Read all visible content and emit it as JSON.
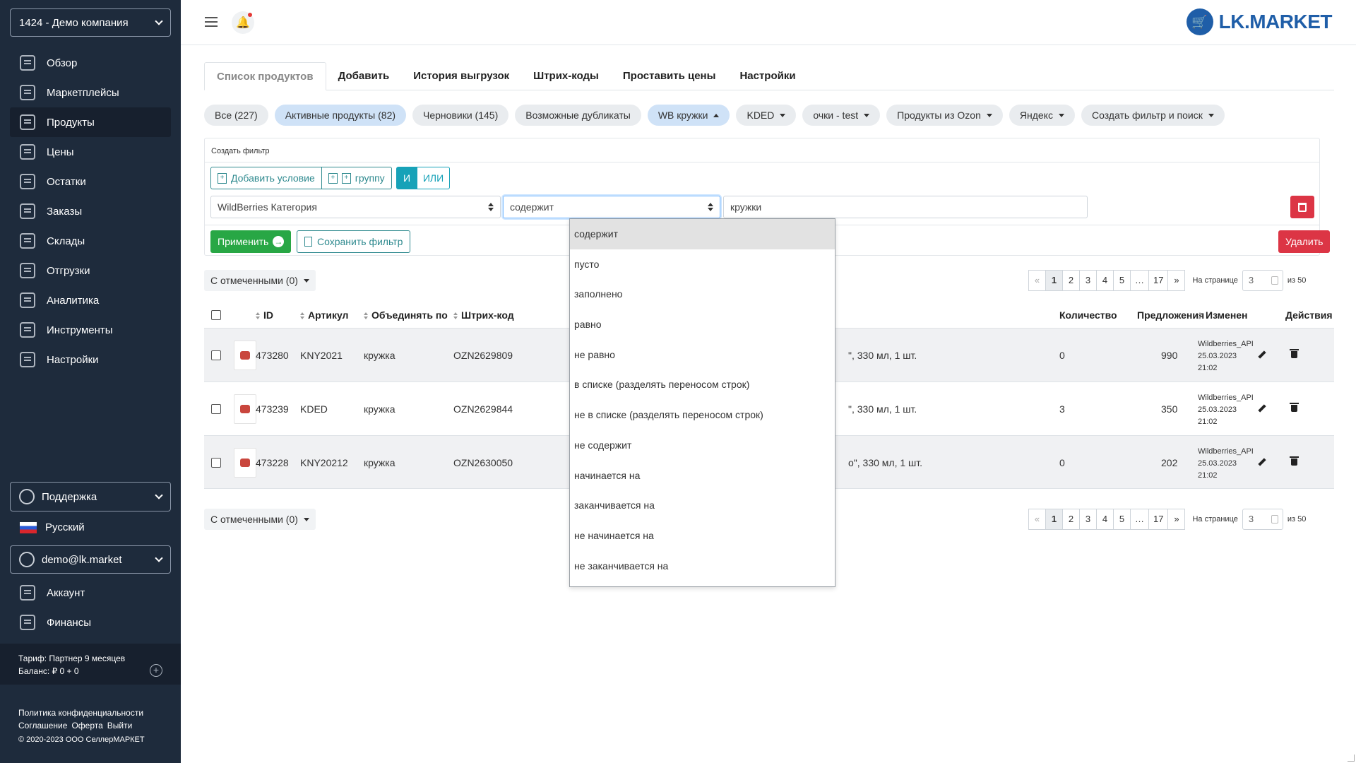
{
  "sidebar": {
    "company": "1424 - Демо компания",
    "nav": [
      {
        "label": "Обзор",
        "icon": "overview-icon"
      },
      {
        "label": "Маркетплейсы",
        "icon": "marketplaces-icon"
      },
      {
        "label": "Продукты",
        "icon": "products-icon",
        "active": true
      },
      {
        "label": "Цены",
        "icon": "prices-icon"
      },
      {
        "label": "Остатки",
        "icon": "stock-icon"
      },
      {
        "label": "Заказы",
        "icon": "orders-icon"
      },
      {
        "label": "Склады",
        "icon": "warehouses-icon"
      },
      {
        "label": "Отгрузки",
        "icon": "shipments-icon"
      },
      {
        "label": "Аналитика",
        "icon": "analytics-icon"
      },
      {
        "label": "Инструменты",
        "icon": "tools-icon"
      },
      {
        "label": "Настройки",
        "icon": "settings-icon"
      }
    ],
    "support": "Поддержка",
    "language": "Русский",
    "user": "demo@lk.market",
    "nav2": [
      {
        "label": "Аккаунт",
        "icon": "account-icon"
      },
      {
        "label": "Финансы",
        "icon": "finance-icon"
      }
    ],
    "tariff": "Тариф: Партнер 9 месяцев",
    "balance": "Баланс: ₽ 0 + 0",
    "footer": {
      "privacy": "Политика конфиденциальности",
      "agreement": "Соглашение",
      "offer": "Оферта",
      "logout": "Выйти",
      "copyright": "© 2020-2023 ООО СеллерМАРКЕТ"
    }
  },
  "header": {
    "logo_text": "LK.MARKET"
  },
  "tabs": [
    "Список продуктов",
    "Добавить",
    "История выгрузок",
    "Штрих-коды",
    "Проставить цены",
    "Настройки"
  ],
  "filter_pills": [
    {
      "label": "Все (227)"
    },
    {
      "label": "Активные продукты (82)",
      "selected": true
    },
    {
      "label": "Черновики (145)"
    },
    {
      "label": "Возможные дубликаты"
    },
    {
      "label": "WB кружки",
      "selected": true,
      "caret": "up"
    },
    {
      "label": "KDED",
      "caret": "down"
    },
    {
      "label": "очки - test",
      "caret": "down"
    },
    {
      "label": "Продукты из Ozon",
      "caret": "down"
    },
    {
      "label": "Яндекс",
      "caret": "down"
    },
    {
      "label": "Создать фильтр и поиск",
      "caret": "down"
    }
  ],
  "filter_panel": {
    "title": "Создать фильтр",
    "add_condition": "Добавить условие",
    "add_group": "группу",
    "and_label": "И",
    "or_label": "ИЛИ",
    "field_value": "WildBerries Категория",
    "operator_value": "содержит",
    "value_input": "кружки",
    "apply": "Применить",
    "save": "Сохранить фильтр",
    "delete": "Удалить"
  },
  "bulk_label": "С отмеченными (0)",
  "pagination": {
    "prev": "«",
    "pages": [
      "1",
      "2",
      "3",
      "4",
      "5",
      "…",
      "17"
    ],
    "next": "»",
    "per_page_label": "На странице",
    "per_page_value": "3",
    "total": "из 50"
  },
  "table": {
    "headers": {
      "id": "ID",
      "article": "Артикул",
      "group_by": "Объединять по",
      "barcode": "Штрих-код",
      "quantity": "Количество",
      "offers": "Предложения",
      "changed": "Изменен",
      "actions": "Действия"
    },
    "rows": [
      {
        "id": "473280",
        "article": "KNY2021",
        "group_by": "кружка",
        "barcode": "OZN2629809",
        "name_tail": "\", 330 мл, 1 шт.",
        "quantity": "0",
        "offers": "990",
        "changed_by": "Wildberries_API",
        "changed_date": "25.03.2023",
        "changed_time": "21:02"
      },
      {
        "id": "473239",
        "article": "KDED",
        "group_by": "кружка",
        "barcode": "OZN2629844",
        "name_tail": "\", 330 мл, 1 шт.",
        "quantity": "3",
        "offers": "350",
        "changed_by": "Wildberries_API",
        "changed_date": "25.03.2023",
        "changed_time": "21:02"
      },
      {
        "id": "473228",
        "article": "KNY20212",
        "group_by": "кружка",
        "barcode": "OZN2630050",
        "name_tail": "o\", 330 мл, 1 шт.",
        "quantity": "0",
        "offers": "202",
        "changed_by": "Wildberries_API",
        "changed_date": "25.03.2023",
        "changed_time": "21:02"
      }
    ]
  },
  "operator_dropdown": {
    "options": [
      "содержит",
      "пусто",
      "заполнено",
      "равно",
      "не равно",
      "в списке (разделять переносом строк)",
      "не в списке (разделять переносом строк)",
      "не содержит",
      "начинается на",
      "заканчивается на",
      "не начинается на",
      "не заканчивается на"
    ],
    "highlighted": "содержит"
  },
  "colors": {
    "sidebar_bg": "#1e2b3c",
    "accent": "#17a2b8",
    "success": "#28a745",
    "danger": "#dc3545",
    "brand": "#1f5ea8"
  }
}
